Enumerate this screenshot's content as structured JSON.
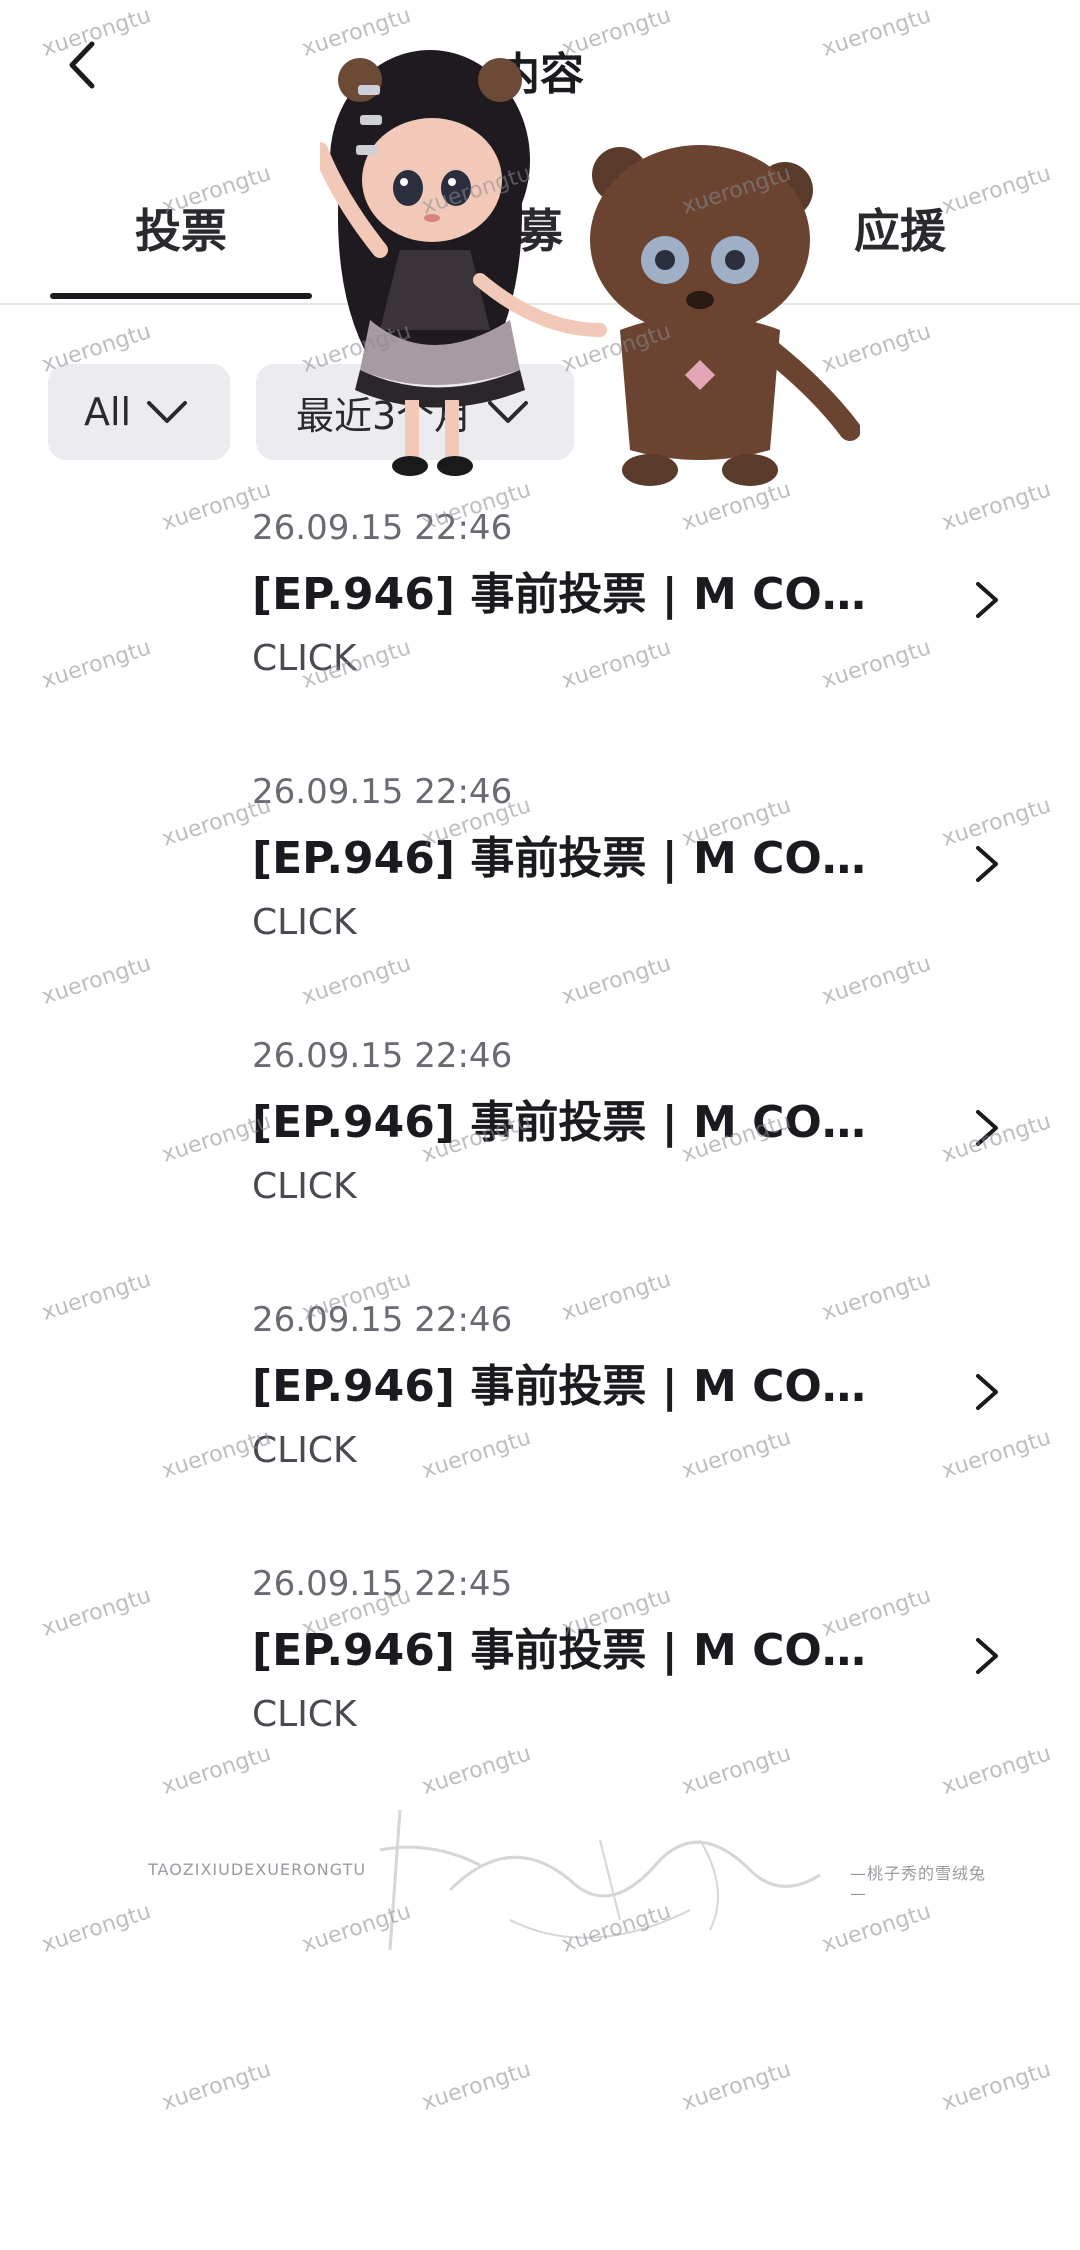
{
  "header": {
    "back_icon": "chevron-left-icon",
    "title": "内容"
  },
  "tabs": [
    {
      "label": "投票",
      "active": true
    },
    {
      "label": "募",
      "active": false
    },
    {
      "label": "应援",
      "active": false
    }
  ],
  "filters": {
    "type": {
      "label": "All",
      "icon": "chevron-down-icon"
    },
    "period": {
      "label": "最近3个月",
      "icon": "chevron-down-icon"
    }
  },
  "items": [
    {
      "date": "26.09.15 22:46",
      "title": "[EP.946] 事前投票 | M COU...",
      "source": "CLICK"
    },
    {
      "date": "26.09.15 22:46",
      "title": "[EP.946] 事前投票 | M COU...",
      "source": "CLICK"
    },
    {
      "date": "26.09.15 22:46",
      "title": "[EP.946] 事前投票 | M COU...",
      "source": "CLICK"
    },
    {
      "date": "26.09.15 22:46",
      "title": "[EP.946] 事前投票 | M COU...",
      "source": "CLICK"
    },
    {
      "date": "26.09.15 22:45",
      "title": "[EP.946] 事前投票 | M COU...",
      "source": "CLICK"
    }
  ],
  "watermark": {
    "text": "xuerongtu",
    "signature_left": "TAOZIXIUDEXUERONGTU",
    "signature_right": "—桃子秀的雪绒兔—",
    "signature_script": "桃子秀的雪绒兔"
  },
  "colors": {
    "text": "#1b1b1f",
    "chip_bg": "#ececf0",
    "muted": "#6a6a72"
  }
}
